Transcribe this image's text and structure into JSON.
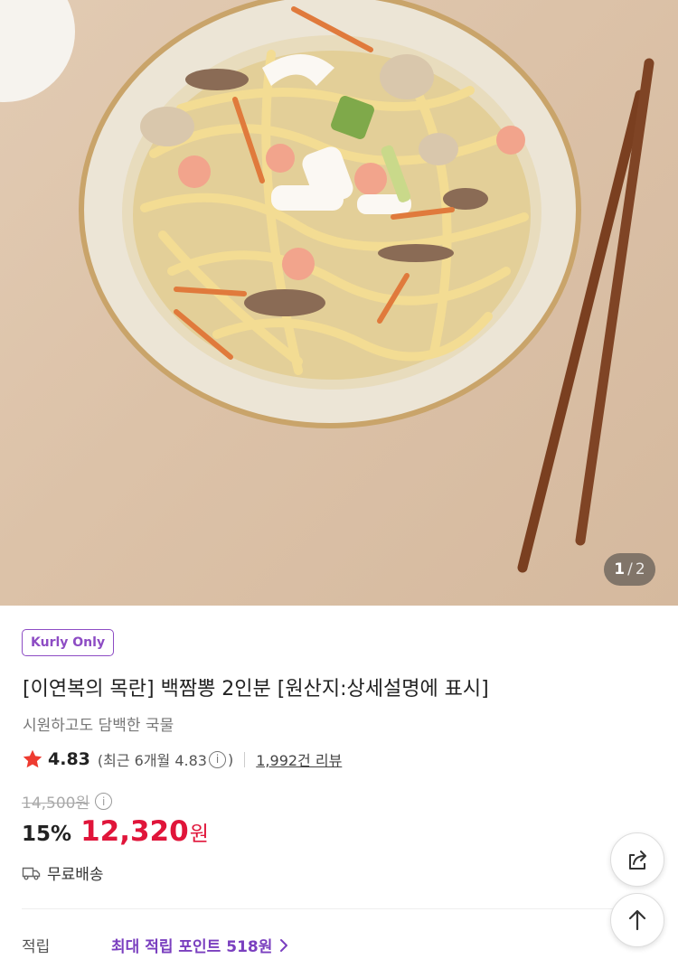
{
  "hero": {
    "image_alt": "백짬뽕 product photo",
    "page_current": "1",
    "page_separator": "/",
    "page_total": "2"
  },
  "product": {
    "badge": "Kurly Only",
    "title": "[이연복의 목란] 백짬뽕 2인분 [원산지:상세설명에 표시]",
    "subtitle": "시원하고도 담백한 국물",
    "rating": "4.83",
    "recent_rating_prefix": "(최근 6개월 4.83",
    "recent_rating_suffix": ")",
    "reviews": "1,992건 리뷰",
    "original_price": "14,500원",
    "discount": "15%",
    "price": "12,320",
    "currency": "원",
    "shipping": "무료배송",
    "points_label": "적립",
    "points_value": "최대 적립 포인트 518원"
  },
  "colors": {
    "accent_purple": "#8d4cc4",
    "price_red": "#e0153a",
    "star_red": "#ee3b30"
  },
  "icons": {
    "star": "star-icon",
    "info": "info-icon",
    "truck": "truck-icon",
    "share": "share-icon",
    "top": "arrow-up-icon",
    "chevron": "chevron-right-icon"
  }
}
